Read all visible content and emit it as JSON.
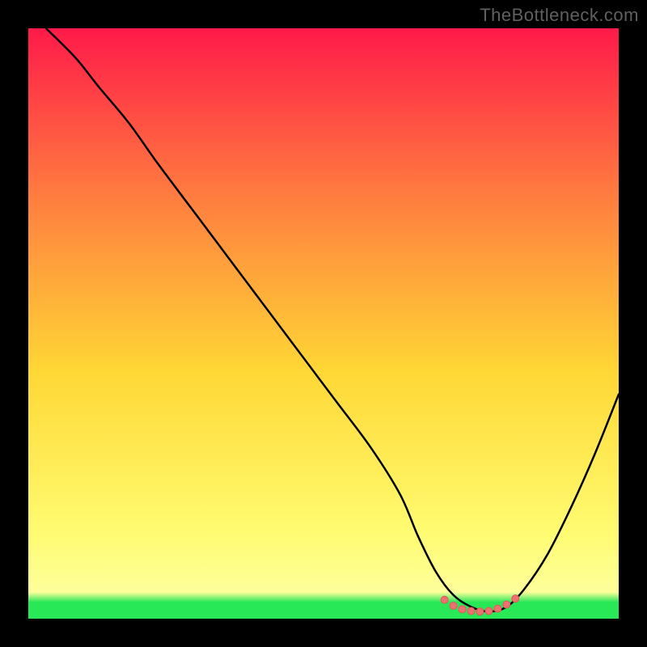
{
  "watermark": "TheBottleneck.com",
  "colors": {
    "gradient_top": "#ff1a49",
    "gradient_mid_upper": "#ff823f",
    "gradient_mid": "#ffd735",
    "gradient_mid_lower": "#fffb70",
    "gradient_bottom_yellow": "#feff9a",
    "gradient_bottom_green": "#28e858",
    "curve": "#000000",
    "marker_fill": "#ef7070",
    "marker_stroke": "#e05858",
    "background": "#000000"
  },
  "chart_data": {
    "type": "line",
    "title": "",
    "xlabel": "",
    "ylabel": "",
    "xlim": [
      0,
      100
    ],
    "ylim": [
      0,
      100
    ],
    "grid": false,
    "legend": false,
    "series": [
      {
        "name": "curve",
        "x": [
          3,
          8,
          12,
          17,
          22,
          28,
          34,
          40,
          46,
          52,
          58,
          63,
          66,
          69,
          72,
          75,
          78,
          81,
          84,
          88,
          92,
          96,
          100
        ],
        "y": [
          100,
          95,
          90,
          84,
          77,
          69,
          61,
          53,
          45,
          37,
          29,
          21,
          14,
          8,
          4,
          2,
          1.2,
          2,
          5,
          11,
          19,
          28,
          38
        ]
      }
    ],
    "markers": {
      "name": "highlight-band",
      "x": [
        70.5,
        72,
        73.5,
        75,
        76.5,
        78,
        79.5,
        81,
        82.5
      ],
      "y": [
        3.2,
        2.2,
        1.6,
        1.3,
        1.2,
        1.3,
        1.7,
        2.4,
        3.4
      ]
    }
  }
}
